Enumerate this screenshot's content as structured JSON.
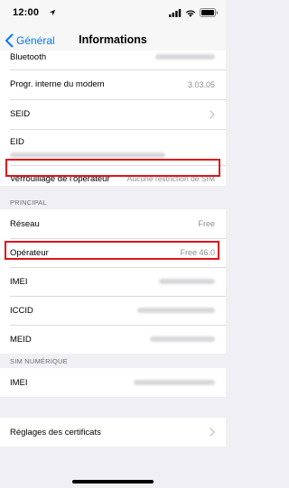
{
  "status": {
    "time": "12:00"
  },
  "nav": {
    "back_label": "Général",
    "title": "Informations"
  },
  "about_rows": [
    {
      "label": "Bluetooth",
      "value": ""
    },
    {
      "label": "Progr. interne du modem",
      "value": "3.03.05"
    },
    {
      "label": "SEID",
      "value": ""
    },
    {
      "label": "EID",
      "value": ""
    },
    {
      "label": "Verrouillage de l'opérateur",
      "value": "Aucune restriction de SIM"
    }
  ],
  "principal": {
    "header": "PRINCIPAL",
    "rows": [
      {
        "label": "Réseau",
        "value": "Free"
      },
      {
        "label": "Opérateur",
        "value": "Free 46.0"
      },
      {
        "label": "IMEI",
        "value": ""
      },
      {
        "label": "ICCID",
        "value": ""
      },
      {
        "label": "MEID",
        "value": ""
      }
    ]
  },
  "esim": {
    "header": "SIM NUMÉRIQUE",
    "rows": [
      {
        "label": "IMEI",
        "value": ""
      }
    ]
  },
  "certs": {
    "label": "Réglages des certificats"
  },
  "colors": {
    "accent": "#007aff",
    "highlight": "#e0141a",
    "background": "#efeff4"
  }
}
